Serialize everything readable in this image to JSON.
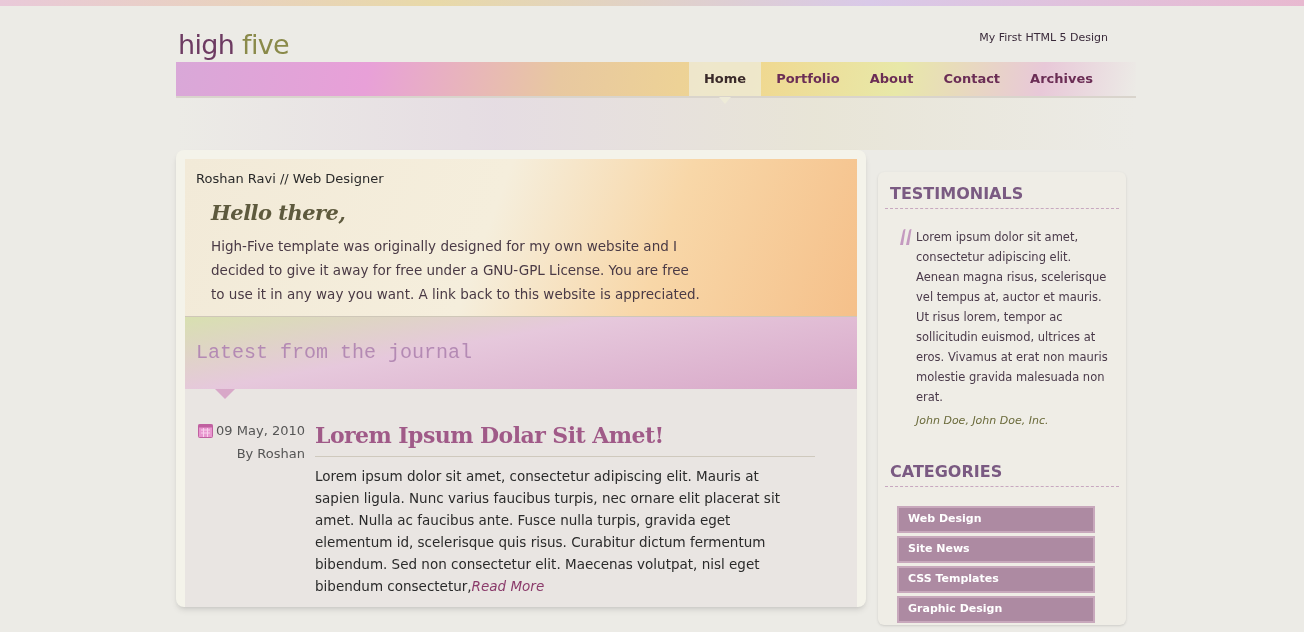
{
  "header": {
    "logo": {
      "first": "high",
      "second": "five"
    },
    "tagline": "My First HTML 5 Design"
  },
  "nav": [
    {
      "label": "Home",
      "selected": true
    },
    {
      "label": "Portfolio",
      "selected": false
    },
    {
      "label": "About",
      "selected": false
    },
    {
      "label": "Contact",
      "selected": false
    },
    {
      "label": "Archives",
      "selected": false
    }
  ],
  "intro": {
    "byline": "Roshan Ravi // Web Designer",
    "greeting": "Hello there,",
    "text": "High-Five template was originally designed for my own website and I decided to give it away for free under a GNU-GPL License. You are free to use it in any way you want. A link back to this website is appreciated."
  },
  "journal": {
    "title": "Latest from the journal",
    "post": {
      "date": "09 May, 2010",
      "author": "By Roshan",
      "title": "Lorem Ipsum Dolar Sit Amet!",
      "body": "Lorem ipsum dolor sit amet, consectetur adipiscing elit. Mauris at sapien ligula. Nunc varius faucibus turpis, nec ornare elit placerat sit amet. Nulla ac faucibus ante. Fusce nulla turpis, gravida eget elementum id, scelerisque quis risus. Curabitur dictum fermentum bibendum. Sed non consectetur elit. Maecenas volutpat, nisl eget bibendum consectetur,",
      "link": "Read More"
    }
  },
  "sidebar": {
    "testimonials": {
      "title": "TESTIMONIALS",
      "quote": "Lorem ipsum dolor sit amet, consectetur adipiscing elit. Aenean magna risus, scelerisque vel tempus at, auctor et mauris. Ut risus lorem, tempor ac sollicitudin euismod, ultrices at eros. Vivamus at erat non mauris molestie gravida malesuada non erat.",
      "author": "John Doe, John Doe, Inc."
    },
    "categories": {
      "title": "CATEGORIES",
      "items": [
        "Web Design",
        "Site News",
        "CSS Templates",
        "Graphic Design"
      ]
    }
  }
}
